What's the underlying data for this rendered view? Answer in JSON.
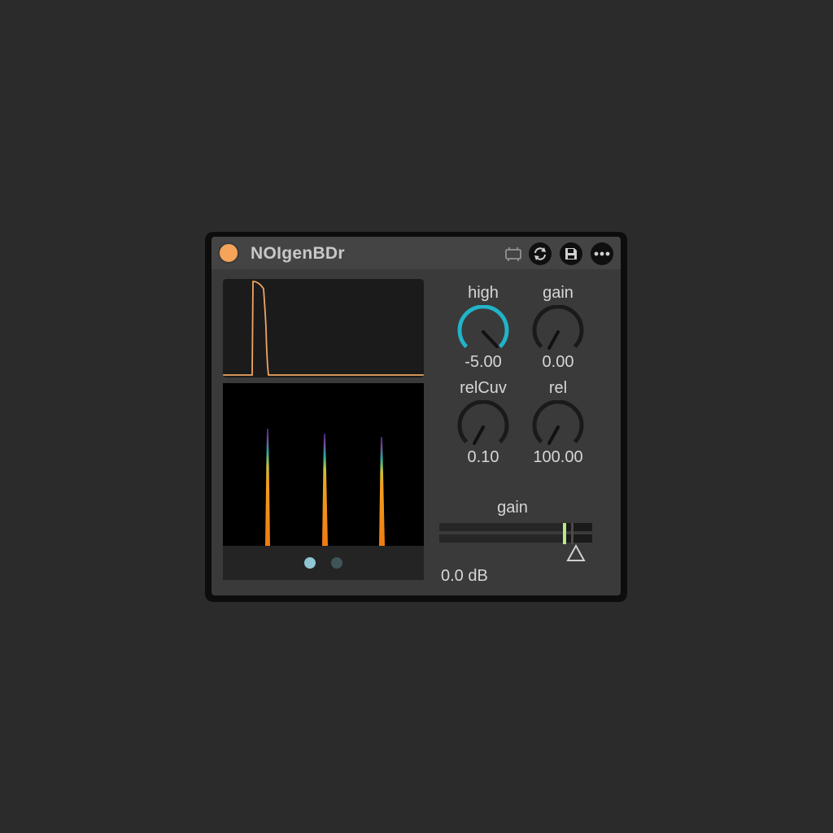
{
  "device": {
    "title": "NOIgenBDr",
    "power_color": "#f5a45a",
    "accent_color": "#22b3c8"
  },
  "titlebar_icons": [
    "hot-swap-icon",
    "refresh-icon",
    "save-icon",
    "more-icon"
  ],
  "knobs": [
    {
      "label": "high",
      "value": "-5.00",
      "level": 0.35
    },
    {
      "label": "gain",
      "value": "0.00",
      "level": 0.2
    },
    {
      "label": "relCuv",
      "value": "0.10",
      "level": 0.2
    },
    {
      "label": "rel",
      "value": "100.00",
      "level": 0.2
    }
  ],
  "gain_slider": {
    "label": "gain",
    "value": "0.0 dB"
  },
  "spectrogram": {
    "pages": 2,
    "active_page": 1
  }
}
